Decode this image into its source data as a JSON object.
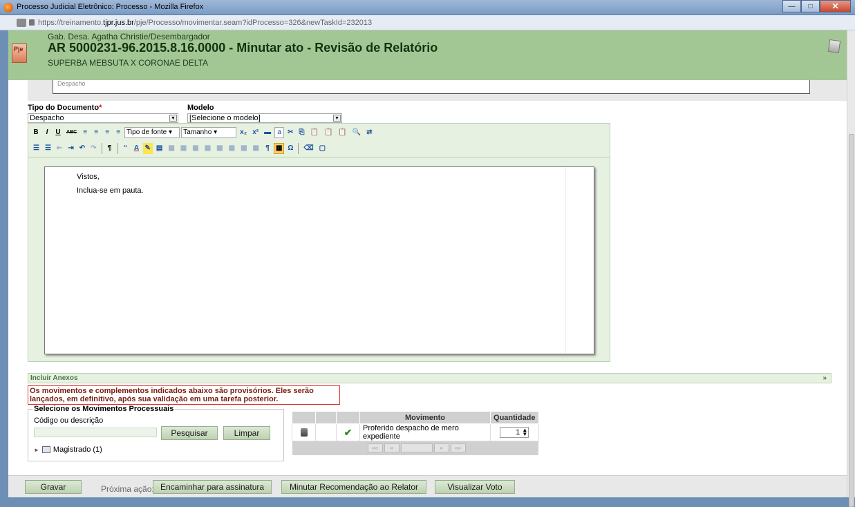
{
  "window": {
    "title": "Processo Judicial Eletrônico: Processo - Mozilla Firefox",
    "minimize": "—",
    "maximize": "□",
    "close": "✕"
  },
  "browser": {
    "url_prefix": "https://treinamento.",
    "url_domain": "tjpr.jus.br",
    "url_path": "/pje/Processo/movimentar.seam?idProcesso=326&newTaskId=232013"
  },
  "header": {
    "logo_text": "Pje",
    "org": "Gab. Desa. Agatha Christie/Desembargador",
    "process": "AR 5000231-96.2015.8.16.0000 - Minutar ato - Revisão de Relatório",
    "parties": "SUPERBA MEBSUTA X CORONAE DELTA"
  },
  "previous_doc": {
    "label": "Despacho"
  },
  "form": {
    "tipo_label": "Tipo do Documento",
    "tipo_required": "*",
    "tipo_value": "Despacho",
    "modelo_label": "Modelo",
    "modelo_value": "[Selecione o modelo]",
    "select_arrow": "▼"
  },
  "toolbar": {
    "row1": [
      "B",
      "I",
      "U",
      "ABC",
      "≡",
      "≡",
      "≡",
      "≡"
    ],
    "font_family": "Tipo de fonte",
    "font_size": "Tamanho",
    "dropdown_arrow": "▾",
    "sub": "x₂",
    "sup": "x²",
    "row1b": [
      "▬",
      "a",
      "✂",
      "⎘",
      "📋",
      "📋",
      "📋",
      "🔍",
      "⇄"
    ],
    "row2": [
      "☰",
      "☰",
      "⇤",
      "⇥",
      "↶",
      "↷",
      "¶",
      "“",
      "A",
      "✎",
      "▤",
      "▦",
      "▦",
      "▦",
      "▦",
      "▦",
      "▦",
      "▦",
      "▦",
      "¶",
      "▦",
      "Ω",
      "⌫",
      "▢"
    ]
  },
  "editor": {
    "line1": "Vistos,",
    "line2": "Inclua-se em pauta."
  },
  "anexos": {
    "label": "Incluir Anexos",
    "chevron": "»"
  },
  "warning": {
    "text": "Os movimentos e complementos indicados abaixo são provisórios. Eles serão lançados, em definitivo, após sua validação em uma tarefa posterior."
  },
  "movimentos": {
    "legend": "Selecione os Movimentos Processuais",
    "search_label": "Código ou descrição",
    "search_value": "",
    "pesquisar": "Pesquisar",
    "limpar": "Limpar",
    "tree_expander": "►",
    "tree_item": "Magistrado (1)"
  },
  "table": {
    "col_movimento": "Movimento",
    "col_quantidade": "Quantidade",
    "rows": [
      {
        "movimento": "Proferido despacho de mero expediente",
        "quantidade": "1",
        "check": "✔"
      }
    ],
    "pager": [
      "««",
      "«",
      "",
      "»",
      "»»"
    ],
    "spin_up": "▲",
    "spin_down": "▼"
  },
  "footer": {
    "gravar": "Gravar",
    "proxima_label": "Próxima ação:",
    "encaminhar": "Encaminhar para assinatura",
    "minutar": "Minutar Recomendação ao Relator",
    "visualizar": "Visualizar Voto"
  }
}
